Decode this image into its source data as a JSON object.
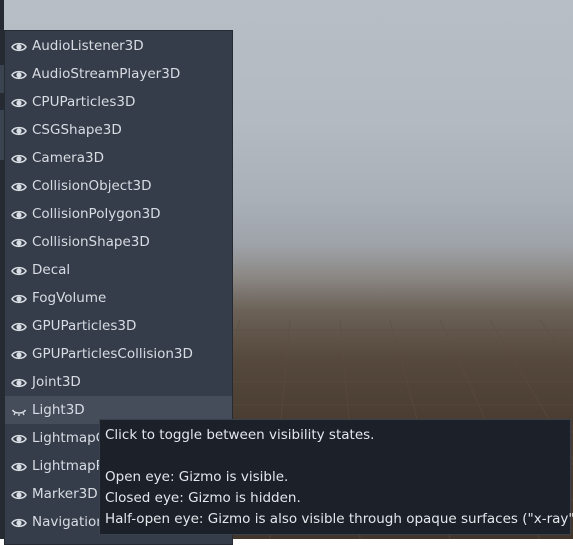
{
  "gizmo_menu": {
    "items": [
      {
        "label": "AudioListener3D",
        "icon": "eye-open-icon"
      },
      {
        "label": "AudioStreamPlayer3D",
        "icon": "eye-open-icon"
      },
      {
        "label": "CPUParticles3D",
        "icon": "eye-open-icon"
      },
      {
        "label": "CSGShape3D",
        "icon": "eye-open-icon"
      },
      {
        "label": "Camera3D",
        "icon": "eye-open-icon"
      },
      {
        "label": "CollisionObject3D",
        "icon": "eye-open-icon"
      },
      {
        "label": "CollisionPolygon3D",
        "icon": "eye-open-icon"
      },
      {
        "label": "CollisionShape3D",
        "icon": "eye-open-icon"
      },
      {
        "label": "Decal",
        "icon": "eye-open-icon"
      },
      {
        "label": "FogVolume",
        "icon": "eye-open-icon"
      },
      {
        "label": "GPUParticles3D",
        "icon": "eye-open-icon"
      },
      {
        "label": "GPUParticlesCollision3D",
        "icon": "eye-open-icon"
      },
      {
        "label": "Joint3D",
        "icon": "eye-open-icon"
      },
      {
        "label": "Light3D",
        "icon": "eye-closed-icon"
      },
      {
        "label": "LightmapG",
        "icon": "eye-open-icon"
      },
      {
        "label": "LightmapP",
        "icon": "eye-open-icon"
      },
      {
        "label": "Marker3D",
        "icon": "eye-open-icon"
      },
      {
        "label": "Navigation",
        "icon": "eye-open-icon"
      }
    ],
    "hovered_item": "Light3D"
  },
  "tooltip": {
    "line1": "Click to toggle between visibility states.",
    "line2": "Open eye: Gizmo is visible.",
    "line3": "Closed eye: Gizmo is hidden.",
    "line4": "Half-open eye: Gizmo is also visible through opaque surfaces (\"x-ray\")."
  },
  "colors": {
    "menu_bg": "#363d4a",
    "menu_hover": "#454d5b",
    "menu_text": "#d8dce3",
    "tooltip_bg": "#1c2028",
    "tooltip_text": "#e4e7ec",
    "icon": "#d8dce3"
  }
}
